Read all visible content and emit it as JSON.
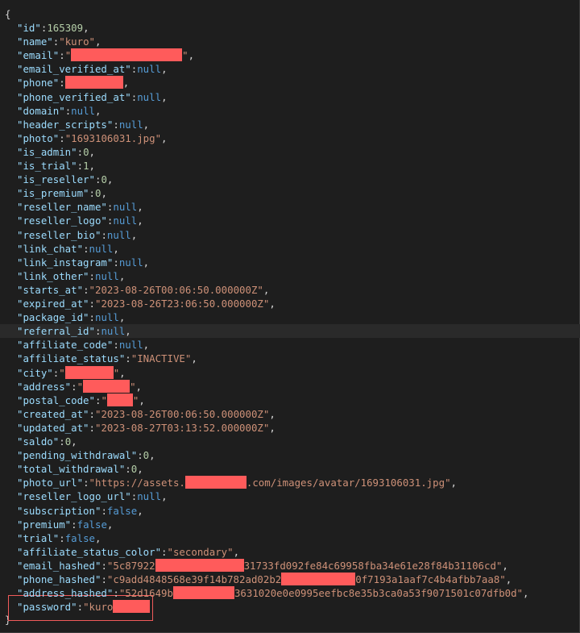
{
  "brace_open": "{",
  "brace_close": "}",
  "fields": [
    {
      "key": "\"id\"",
      "val": "165309",
      "type": "num"
    },
    {
      "key": "\"name\"",
      "val": "\"kuro\"",
      "type": "str"
    },
    {
      "key": "\"email\"",
      "type": "redacted",
      "pre": "\"",
      "post": "\""
    },
    {
      "key": "\"email_verified_at\"",
      "val": "null",
      "type": "nul"
    },
    {
      "key": "\"phone\"",
      "type": "redacted",
      "pre": "",
      "post": ""
    },
    {
      "key": "\"phone_verified_at\"",
      "val": "null",
      "type": "nul"
    },
    {
      "key": "\"domain\"",
      "val": "null",
      "type": "nul"
    },
    {
      "key": "\"header_scripts\"",
      "val": "null",
      "type": "nul"
    },
    {
      "key": "\"photo\"",
      "val": "\"1693106031.jpg\"",
      "type": "str"
    },
    {
      "key": "\"is_admin\"",
      "val": "0",
      "type": "num"
    },
    {
      "key": "\"is_trial\"",
      "val": "1",
      "type": "num"
    },
    {
      "key": "\"is_reseller\"",
      "val": "0",
      "type": "num"
    },
    {
      "key": "\"is_premium\"",
      "val": "0",
      "type": "num"
    },
    {
      "key": "\"reseller_name\"",
      "val": "null",
      "type": "nul"
    },
    {
      "key": "\"reseller_logo\"",
      "val": "null",
      "type": "nul"
    },
    {
      "key": "\"reseller_bio\"",
      "val": "null",
      "type": "nul"
    },
    {
      "key": "\"link_chat\"",
      "val": "null",
      "type": "nul"
    },
    {
      "key": "\"link_instagram\"",
      "val": "null",
      "type": "nul"
    },
    {
      "key": "\"link_other\"",
      "val": "null",
      "type": "nul"
    },
    {
      "key": "\"starts_at\"",
      "val": "\"2023-08-26T00:06:50.000000Z\"",
      "type": "str"
    },
    {
      "key": "\"expired_at\"",
      "val": "\"2023-08-26T23:06:50.000000Z\"",
      "type": "str"
    },
    {
      "key": "\"package_id\"",
      "val": "null",
      "type": "nul"
    },
    {
      "key": "\"referral_id\"",
      "val": "null",
      "type": "nul",
      "highlight": true
    },
    {
      "key": "\"affiliate_code\"",
      "val": "null",
      "type": "nul"
    },
    {
      "key": "\"affiliate_status\"",
      "val": "\"INACTIVE\"",
      "type": "str"
    },
    {
      "key": "\"city\"",
      "type": "redacted",
      "pre": "\"",
      "post": "\""
    },
    {
      "key": "\"address\"",
      "type": "redacted",
      "pre": "\"",
      "post": "\""
    },
    {
      "key": "\"postal_code\"",
      "type": "redacted",
      "pre": "\"",
      "post": "\""
    },
    {
      "key": "\"created_at\"",
      "val": "\"2023-08-26T00:06:50.000000Z\"",
      "type": "str"
    },
    {
      "key": "\"updated_at\"",
      "val": "\"2023-08-27T03:13:52.000000Z\"",
      "type": "str"
    },
    {
      "key": "\"saldo\"",
      "val": "0",
      "type": "num"
    },
    {
      "key": "\"pending_withdrawal\"",
      "val": "0",
      "type": "num"
    },
    {
      "key": "\"total_withdrawal\"",
      "val": "0",
      "type": "num"
    },
    {
      "key": "\"photo_url\"",
      "type": "partial",
      "pre": "\"https://assets.",
      "post": ".com/images/avatar/1693106031.jpg\""
    },
    {
      "key": "\"reseller_logo_url\"",
      "val": "null",
      "type": "nul"
    },
    {
      "key": "\"subscription\"",
      "val": "false",
      "type": "nul"
    },
    {
      "key": "\"premium\"",
      "val": "false",
      "type": "nul"
    },
    {
      "key": "\"trial\"",
      "val": "false",
      "type": "nul"
    },
    {
      "key": "\"affiliate_status_color\"",
      "val": "\"secondary\"",
      "type": "str"
    },
    {
      "key": "\"email_hashed\"",
      "type": "partial",
      "pre": "\"5c87922",
      "post": "31733fd092fe84c69958fba34e61e28f84b31106cd\""
    },
    {
      "key": "\"phone_hashed\"",
      "type": "partial",
      "pre": "\"c9add4848568e39f14b782ad02b2",
      "post": "0f7193a1aaf7c4b4afbb7aa8\""
    },
    {
      "key": "\"address_hashed\"",
      "type": "partial",
      "pre": "\"52d1649b",
      "post": "3631020e0e0995eefbc8e35b3ca0a53f9071501c07dfb0d\""
    },
    {
      "key": "\"password\"",
      "type": "partial",
      "pre": "\"kuro",
      "post": "",
      "last": true
    }
  ]
}
